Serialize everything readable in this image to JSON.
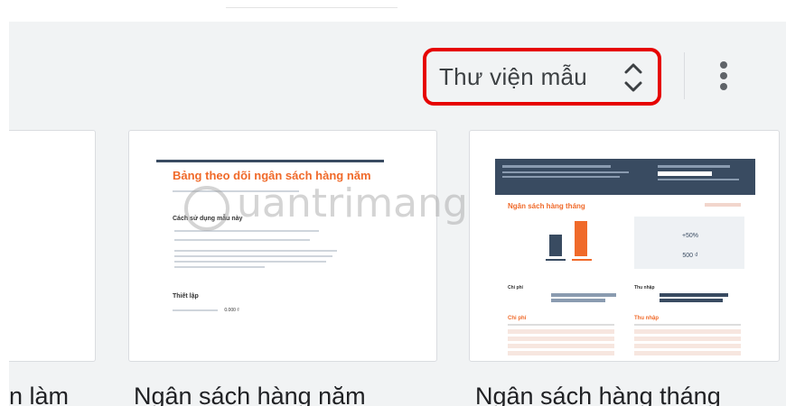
{
  "toolbar": {
    "gallery_select": {
      "label": "Thư viện mẫu"
    }
  },
  "templates": [
    {
      "title": "n làm"
    },
    {
      "title": "Ngân sách hàng năm",
      "preview": {
        "heading": "Bảng theo dõi ngân sách hàng năm",
        "section_how": "Cách sử dụng mẫu này",
        "section_setup": "Thiết lập",
        "start_balance_value": "0.000 ₫"
      }
    },
    {
      "title": "Ngân sách hàng tháng",
      "preview": {
        "heading": "Ngân sách hàng tháng",
        "stat_1": "+50%",
        "stat_2": "500 ₫",
        "section_expense": "Chi phí",
        "section_income": "Thu nhập",
        "section_expense_2": "Chi phí",
        "section_income_2": "Thu nhập"
      }
    }
  ],
  "watermark": {
    "text": "uantrimang"
  },
  "colors": {
    "highlight_border": "#e60000",
    "panel_bg": "#f1f3f4",
    "accent_orange": "#f06a2a",
    "accent_navy": "#394b61"
  }
}
